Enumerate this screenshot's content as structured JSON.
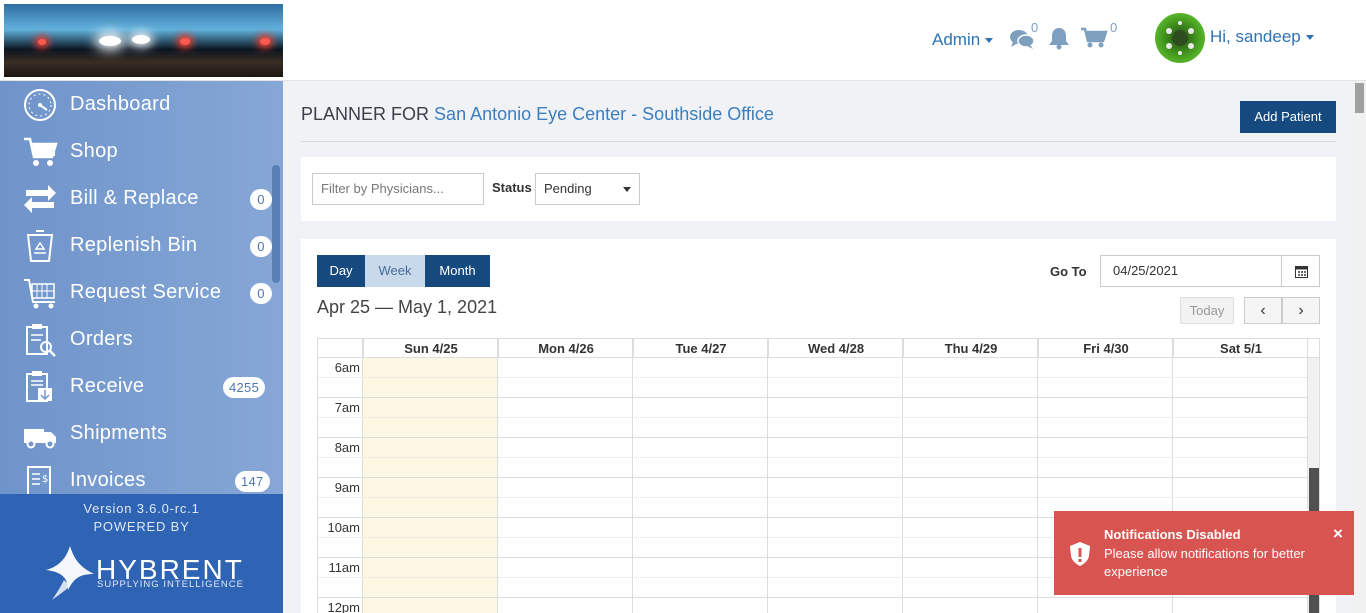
{
  "header": {
    "admin_label": "Admin",
    "messages_count": "0",
    "cart_count": "0",
    "user_greeting": "Hi, sandeep"
  },
  "sidebar": {
    "items": [
      {
        "label": "Dashboard",
        "icon": "dashboard-gauge-icon",
        "badge": ""
      },
      {
        "label": "Shop",
        "icon": "shopping-cart-icon",
        "badge": ""
      },
      {
        "label": "Bill & Replace",
        "icon": "bill-replace-arrows-icon",
        "badge": "0"
      },
      {
        "label": "Replenish Bin",
        "icon": "recycle-bin-icon",
        "badge": "0"
      },
      {
        "label": "Request Service",
        "icon": "request-service-cart-icon",
        "badge": "0"
      },
      {
        "label": "Orders",
        "icon": "orders-clipboard-icon",
        "badge": ""
      },
      {
        "label": "Receive",
        "icon": "receive-clipboard-icon",
        "badge": "4255"
      },
      {
        "label": "Shipments",
        "icon": "delivery-truck-icon",
        "badge": ""
      },
      {
        "label": "Invoices",
        "icon": "invoice-icon",
        "badge": "147"
      }
    ],
    "version": "Version 3.6.0-rc.1",
    "powered_by": "POWERED BY",
    "brand": "HYBRENT",
    "brand_sub": "SUPPLYING INTELLIGENCE"
  },
  "planner": {
    "title_prefix": "PLANNER FOR",
    "office": "San Antonio Eye Center - Southside Office",
    "add_patient": "Add Patient"
  },
  "filters": {
    "physician_placeholder": "Filter by Physicians...",
    "status_label": "Status",
    "status_value": "Pending"
  },
  "calendar": {
    "views": [
      "Day",
      "Week",
      "Month"
    ],
    "active_view": "Week",
    "range": "Apr 25 — May 1, 2021",
    "goto_label": "Go To",
    "goto_value": "04/25/2021",
    "today_label": "Today",
    "prev_symbol": "‹",
    "next_symbol": "›",
    "days": [
      "Sun 4/25",
      "Mon 4/26",
      "Tue 4/27",
      "Wed 4/28",
      "Thu 4/29",
      "Fri 4/30",
      "Sat 5/1"
    ],
    "highlight_day": 0,
    "times": [
      "6am",
      "7am",
      "8am",
      "9am",
      "10am",
      "11am",
      "12pm"
    ]
  },
  "toast": {
    "title": "Notifications Disabled",
    "message": "Please allow notifications for better experience",
    "close": "×"
  },
  "colors": {
    "primary_dark": "#164a7e",
    "link_blue": "#2f73b3",
    "sidebar": "#7498cc",
    "sidebar_footer": "#2f63b3",
    "today_highlight": "#fcf8e3",
    "toast_red": "#d85450"
  }
}
